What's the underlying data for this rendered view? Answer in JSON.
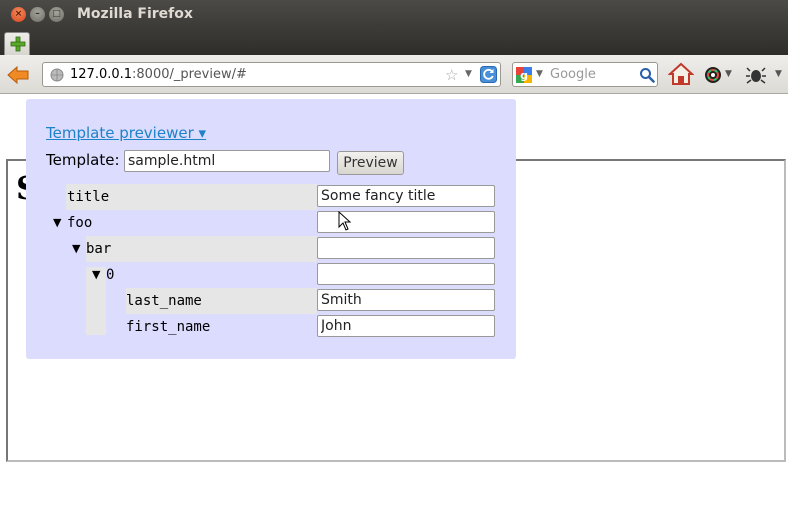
{
  "window": {
    "title": "Mozilla Firefox"
  },
  "navbar": {
    "url_host": "127.0.0.1",
    "url_rest": ":8000/_preview/#",
    "search_placeholder": "Google"
  },
  "page": {
    "heading_fragment": "S"
  },
  "panel": {
    "toggle_link": "Template previewer ▾",
    "template_label": "Template:",
    "template_value": "sample.html",
    "preview_button": "Preview",
    "tree": {
      "title": {
        "key": "title",
        "value": "Some fancy title"
      },
      "foo": {
        "key": "foo",
        "value": ""
      },
      "bar": {
        "key": "bar",
        "value": ""
      },
      "item0": {
        "key": "0",
        "value": ""
      },
      "last_name": {
        "key": "last_name",
        "value": "Smith"
      },
      "first_name": {
        "key": "first_name",
        "value": "John"
      },
      "toggle_glyph": "▼"
    }
  }
}
